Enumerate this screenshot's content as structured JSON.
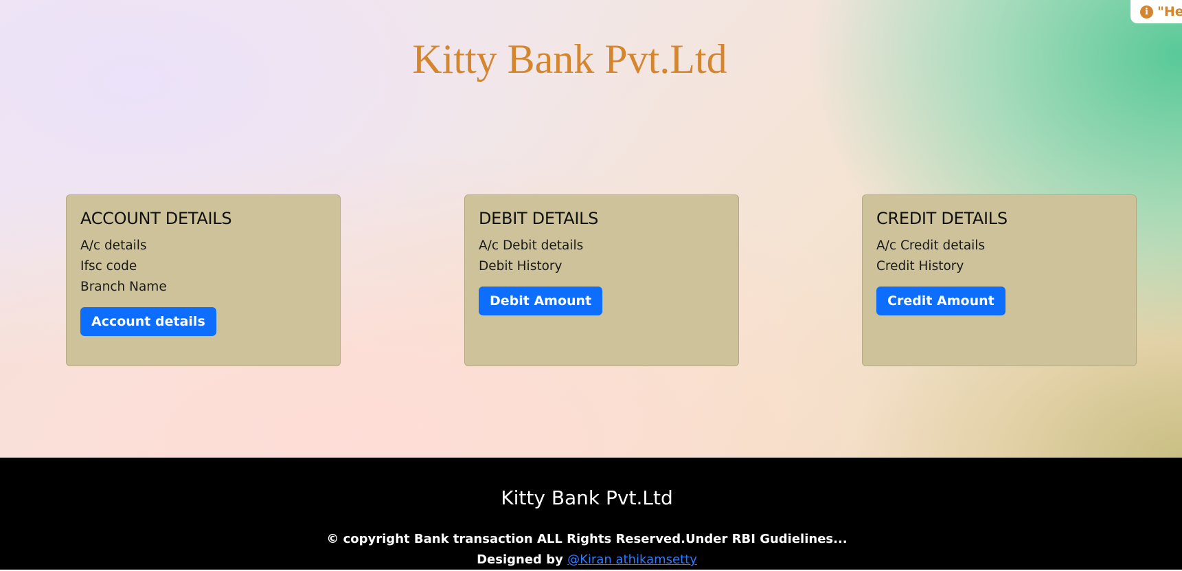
{
  "header": {
    "title": "Kitty Bank Pvt.Ltd"
  },
  "toast": {
    "icon": "info-icon",
    "text": "\"He"
  },
  "cards": [
    {
      "heading": "ACCOUNT DETAILS",
      "lines": [
        "A/c details",
        "Ifsc code",
        "Branch Name"
      ],
      "button": "Account details"
    },
    {
      "heading": "DEBIT DETAILS",
      "lines": [
        "A/c Debit details",
        "Debit History"
      ],
      "button": "Debit Amount"
    },
    {
      "heading": "CREDIT DETAILS",
      "lines": [
        "A/c Credit details",
        "Credit History"
      ],
      "button": "Credit Amount"
    }
  ],
  "footer": {
    "title": "Kitty Bank Pvt.Ltd",
    "copyright": "© copyright Bank transaction ALL Rights Reserved.Under RBI Gudielines...",
    "designed_by_label": "Designed by",
    "designer_link": "@Kiran athikamsetty"
  },
  "colors": {
    "title": "#d4862f",
    "card_bg": "#cdc29a",
    "button_bg": "#0d6efd",
    "footer_bg": "#000000",
    "link": "#2f7bff"
  }
}
